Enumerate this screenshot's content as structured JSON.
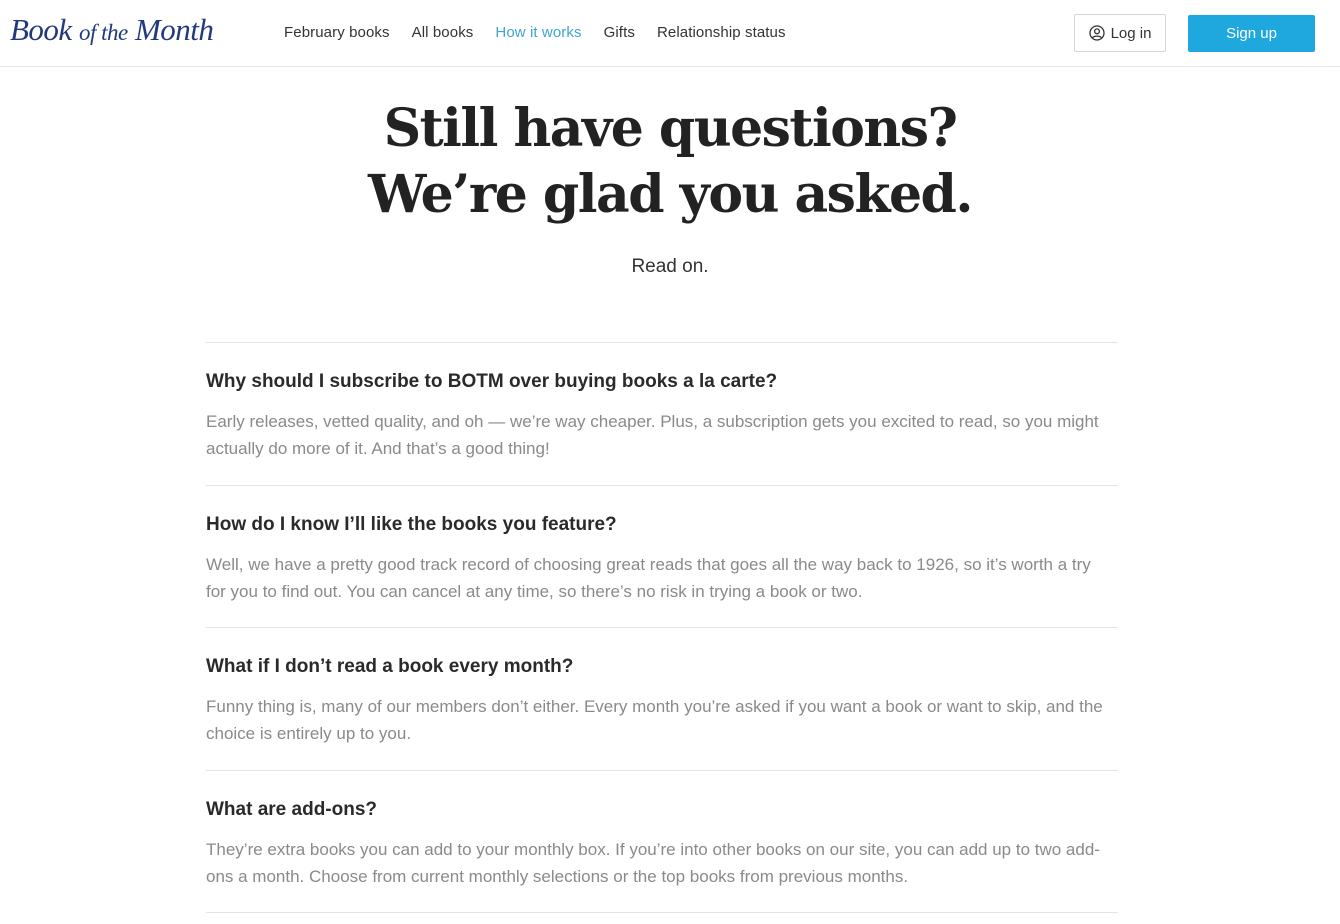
{
  "header": {
    "logo": {
      "part1": "Book",
      "part2": "of the",
      "part3": "Month"
    },
    "nav": [
      {
        "label": "February books",
        "active": false
      },
      {
        "label": "All books",
        "active": false
      },
      {
        "label": "How it works",
        "active": true
      },
      {
        "label": "Gifts",
        "active": false
      },
      {
        "label": "Relationship status",
        "active": false
      }
    ],
    "login_label": "Log in",
    "signup_label": "Sign up"
  },
  "hero": {
    "title_line1": "Still have questions?",
    "title_line2": "We’re glad you asked.",
    "subtitle": "Read on."
  },
  "faq": [
    {
      "question": "Why should I subscribe to BOTM over buying books a la carte?",
      "answer": "Early releases, vetted quality, and oh — we’re way cheaper. Plus, a subscription gets you excited to read, so you might actually do more of it. And that’s a good thing!"
    },
    {
      "question": "How do I know I’ll like the books you feature?",
      "answer": "Well, we have a pretty good track record of choosing great reads that goes all the way back to 1926, so it’s worth a try for you to find out. You can cancel at any time, so there’s no risk in trying a book or two."
    },
    {
      "question": "What if I don’t read a book every month?",
      "answer": "Funny thing is, many of our members don’t either. Every month you’re asked if you want a book or want to skip, and the choice is entirely up to you."
    },
    {
      "question": "What are add-ons?",
      "answer": "They’re extra books you can add to your monthly box. If you’re into other books on our site, you can add up to two add-ons a month. Choose from current monthly selections or the top books from previous months."
    }
  ],
  "colors": {
    "brand": "#22397d",
    "accent": "#1fa8de",
    "active_link": "#3ea6d0"
  },
  "icons": {
    "login": "user-circle-icon"
  }
}
